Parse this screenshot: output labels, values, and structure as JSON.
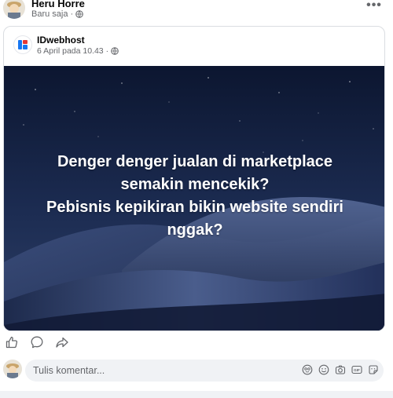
{
  "post": {
    "author": "Heru Horre",
    "time": "Baru saja",
    "privacy_icon": "globe-icon",
    "more_icon": "more-horizontal-icon",
    "more_label": "•••"
  },
  "shared": {
    "page_name": "IDwebhost",
    "date": "6 April pada 10.43",
    "privacy_icon": "globe-icon",
    "logo_colors": [
      "#1877f2",
      "#e53935",
      "#fbc02d"
    ],
    "hero": {
      "lines": [
        "Denger denger jualan di marketplace",
        "semakin mencekik?",
        "Pebisnis kepikiran bikin website sendiri",
        "nggak?"
      ],
      "background": "#0f1a33"
    }
  },
  "actions": [
    {
      "name": "like-icon"
    },
    {
      "name": "comment-icon"
    },
    {
      "name": "share-icon"
    }
  ],
  "comment": {
    "placeholder": "Tulis komentar...",
    "tools": [
      "avatar-sticker-icon",
      "emoji-icon",
      "camera-icon",
      "gif-icon",
      "sticker-icon"
    ]
  }
}
